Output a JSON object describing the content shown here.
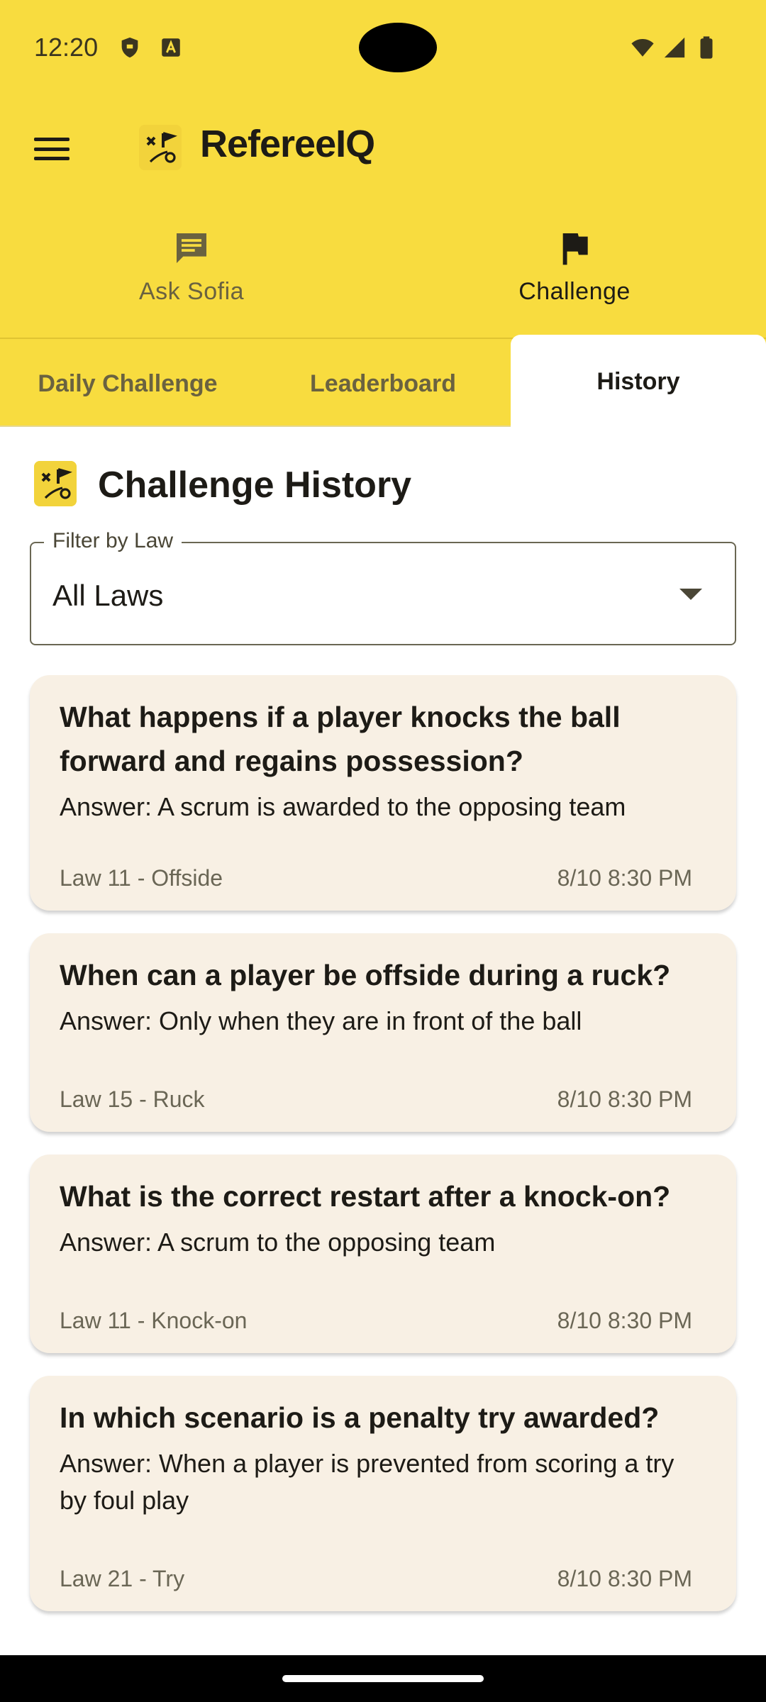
{
  "status_bar": {
    "time": "12:20",
    "icons": [
      "shield-icon",
      "keyboard-a-icon",
      "wifi-icon",
      "signal-icon",
      "battery-icon"
    ]
  },
  "app_bar": {
    "title": "RefereeIQ",
    "menu_icon": "menu-icon",
    "logo_icon": "whistle-flag-logo"
  },
  "nav": {
    "items": [
      {
        "label": "Ask Sofia",
        "icon": "chat-icon",
        "active": false
      },
      {
        "label": "Challenge",
        "icon": "flag-icon",
        "active": true
      }
    ]
  },
  "tabs": {
    "items": [
      {
        "label": "Daily Challenge",
        "active": false
      },
      {
        "label": "Leaderboard",
        "active": false
      },
      {
        "label": "History",
        "active": true
      }
    ]
  },
  "main": {
    "title": "Challenge History",
    "filter": {
      "label": "Filter by Law",
      "value": "All Laws"
    },
    "history": [
      {
        "question": "What happens if a player knocks the ball forward and regains possession?",
        "answer": "Answer: A scrum is awarded to the opposing team",
        "law": "Law 11 - Offside",
        "date": "8/10 8:30 PM"
      },
      {
        "question": "When can a player be offside during a ruck?",
        "answer": "Answer: Only when they are in front of the ball",
        "law": "Law 15 - Ruck",
        "date": "8/10 8:30 PM"
      },
      {
        "question": "What is the correct restart after a knock-on?",
        "answer": "Answer: A scrum to the opposing team",
        "law": "Law 11 - Knock-on",
        "date": "8/10 8:30 PM"
      },
      {
        "question": "In which scenario is a penalty try awarded?",
        "answer": "Answer: When a player is prevented from scoring a try by foul play",
        "law": "Law 21 - Try",
        "date": "8/10 8:30 PM"
      }
    ]
  },
  "colors": {
    "header": "#f8dc3f",
    "card": "#f8f0e4",
    "text": "#1d1b16",
    "muted": "#6a6655"
  }
}
